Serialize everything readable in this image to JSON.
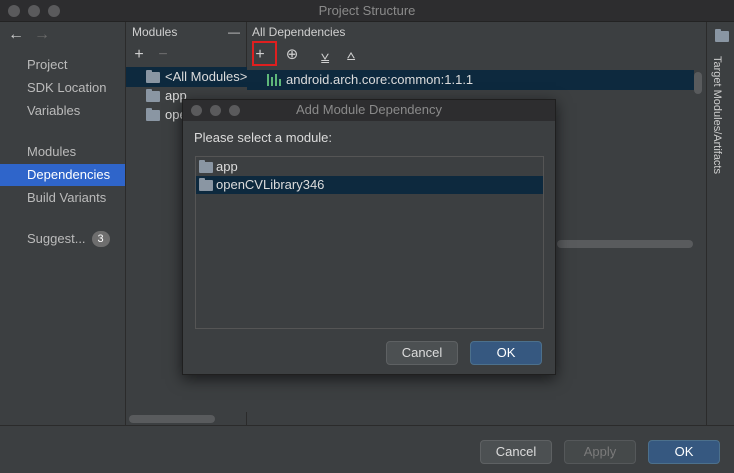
{
  "window": {
    "title": "Project Structure"
  },
  "nav": {
    "items": [
      {
        "label": "Project"
      },
      {
        "label": "SDK Location"
      },
      {
        "label": "Variables"
      },
      {
        "label": "Modules"
      },
      {
        "label": "Dependencies"
      },
      {
        "label": "Build Variants"
      },
      {
        "label": "Suggest..."
      }
    ],
    "selected": "Dependencies",
    "suggest_count": "3"
  },
  "modules_panel": {
    "header": "Modules",
    "collapse_label": "—",
    "add_label": "+",
    "remove_label": "−",
    "items": [
      {
        "label": "<All Modules>"
      },
      {
        "label": "app"
      },
      {
        "label": "openCVLibrary346"
      }
    ]
  },
  "deps_panel": {
    "header": "All Dependencies",
    "items": [
      {
        "label": "android.arch.core:common:1.1.1"
      }
    ]
  },
  "right_strip": {
    "label": "Target Modules/Artifacts"
  },
  "dialog": {
    "title": "Add Module Dependency",
    "prompt": "Please select a module:",
    "items": [
      {
        "label": "app"
      },
      {
        "label": "openCVLibrary346"
      }
    ],
    "selected": "openCVLibrary346",
    "cancel_label": "Cancel",
    "ok_label": "OK"
  },
  "footer": {
    "cancel_label": "Cancel",
    "apply_label": "Apply",
    "ok_label": "OK"
  },
  "colors": {
    "selection": "#2f65ca",
    "highlight": "#e01f1f",
    "default_button": "#365880"
  }
}
